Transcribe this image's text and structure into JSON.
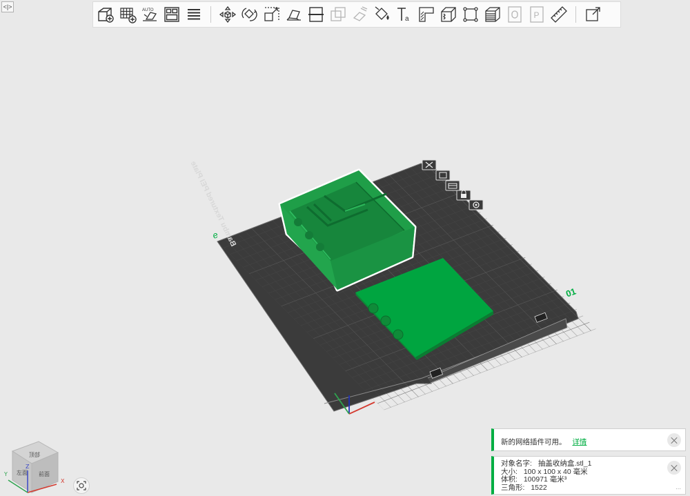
{
  "toolbar": {
    "groups": [
      [
        "add-object",
        "add-plate",
        "auto-orient",
        "arrange",
        "split-plates"
      ],
      [
        "move",
        "rotate",
        "scale",
        "lay-on-face",
        "cut",
        "mesh-boolean",
        "support-paint",
        "color-paint",
        "text-emboss",
        "seam-paint",
        "fuzzy-skin",
        "measure-frame",
        "variable-layer-height",
        "assembly",
        "plate-p",
        "ruler"
      ],
      [
        "export-view"
      ]
    ]
  },
  "plate": {
    "name_label": "Bambu Textured PEI Plate",
    "index_left": "e",
    "index_right": "01"
  },
  "notifications": {
    "plugin": {
      "text": "新的网络插件可用。",
      "link": "详情"
    },
    "object_info": {
      "name_label": "对象名字:",
      "name_value": "抽盖收纳盒.stl_1",
      "size_label": "大小:",
      "size_value": "100 x 100 x 40 毫米",
      "volume_label": "体积:",
      "volume_value": "100971 毫米³",
      "triangles_label": "三角形:",
      "triangles_value": "1522"
    }
  },
  "view_cube": {
    "top": "顶部",
    "left": "左面",
    "front": "前面",
    "axis_y": "Y",
    "axis_z": "Z",
    "axis_x": "X"
  },
  "colors": {
    "accent": "#00ae42",
    "model_green": "#1f9e48",
    "plate_dark": "#3b3b3b"
  }
}
